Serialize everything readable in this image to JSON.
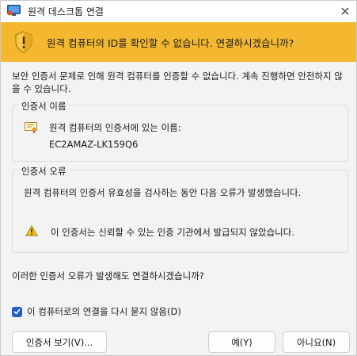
{
  "window": {
    "title": "원격 데스크톱 연결",
    "close_glyph": "✕"
  },
  "banner": {
    "message": "원격 컴퓨터의 ID를 확인할 수 없습니다. 연결하시겠습니까?",
    "icon": "shield-warning-icon",
    "color": "#f4b830"
  },
  "intro": {
    "text": "보안 인증서 문제로 인해 원격 컴퓨터를 인증할 수 없습니다. 계속 진행하면 안전하지 않을 수 있습니다."
  },
  "certificate_name_group": {
    "title": "인증서 이름",
    "label": "원격 컴퓨터의 인증서에 있는 이름:",
    "name": "EC2AMAZ-LK159Q6",
    "icon": "certificate-icon"
  },
  "certificate_error_group": {
    "title": "인증서 오류",
    "description": "원격 컴퓨터의 인증서 유효성을 검사하는 동안 다음 오류가 발생했습니다.",
    "error": "이 인증서는 신뢰할 수 있는 인증 기관에서 발급되지 않았습니다.",
    "icon": "warning-icon"
  },
  "question": "이러한 인증서 오류가 발생해도 연결하시겠습니까?",
  "dont_ask": {
    "label": "이 컴퓨터로의 연결을 다시 묻지 않음(D)",
    "checked": true
  },
  "buttons": {
    "view_certificate": "인증서 보기(V)...",
    "yes": "예(Y)",
    "no": "아니요(N)"
  }
}
